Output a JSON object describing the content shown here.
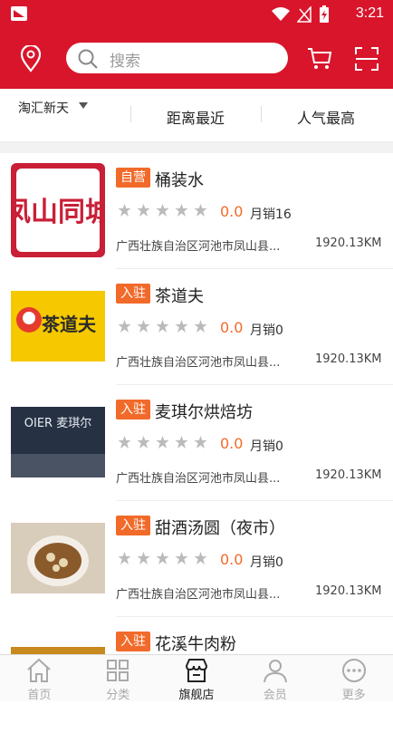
{
  "statusbar": {
    "time": "3:21"
  },
  "search": {
    "placeholder": "搜索"
  },
  "filter": {
    "area": "淘汇新天",
    "tabs": [
      "距离最近",
      "人气最高"
    ]
  },
  "stores": [
    {
      "badge": "自营",
      "name": "桶装水",
      "rating": "0.0",
      "sales": "月销16",
      "address": "广西壮族自治区河池市凤山县...",
      "distance": "1920.13KM"
    },
    {
      "badge": "入驻",
      "name": "茶道夫",
      "rating": "0.0",
      "sales": "月销0",
      "address": "广西壮族自治区河池市凤山县...",
      "distance": "1920.13KM"
    },
    {
      "badge": "入驻",
      "name": "麦琪尔烘焙坊",
      "rating": "0.0",
      "sales": "月销0",
      "address": "广西壮族自治区河池市凤山县...",
      "distance": "1920.13KM"
    },
    {
      "badge": "入驻",
      "name": "甜酒汤圆（夜市）",
      "rating": "0.0",
      "sales": "月销0",
      "address": "广西壮族自治区河池市凤山县...",
      "distance": "1920.13KM"
    },
    {
      "badge": "入驻",
      "name": "花溪牛肉粉"
    }
  ],
  "thumbs": {
    "store0_text": "凤山同城",
    "store1_text": "茶道夫",
    "store2_text": "OIER 麦琪尔"
  },
  "nav": {
    "items": [
      "首页",
      "分类",
      "旗舰店",
      "会员",
      "更多"
    ],
    "active": 2
  },
  "colors": {
    "brand": "#d9152b",
    "badge": "#f26a2a"
  }
}
